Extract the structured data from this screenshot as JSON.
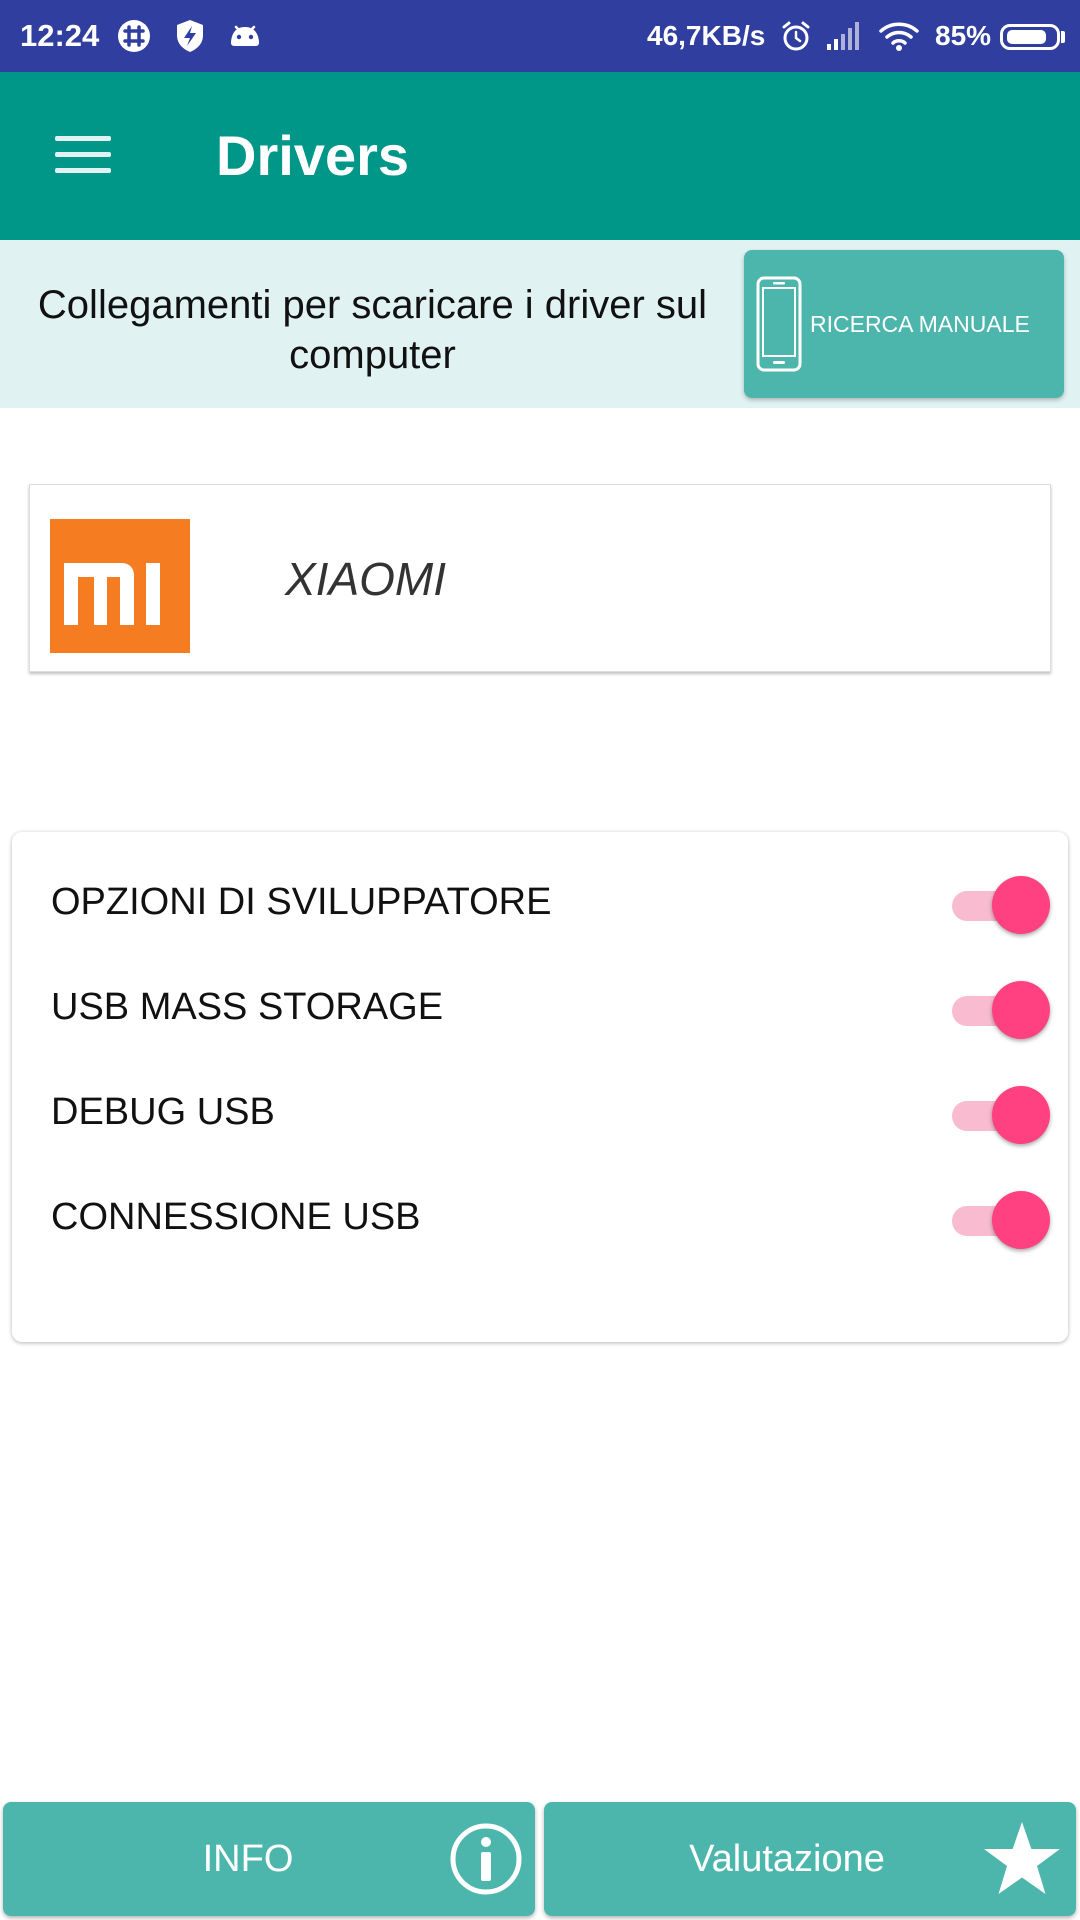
{
  "status_bar": {
    "time": "12:24",
    "notification_icons": [
      "slack-icon",
      "shield-bolt-icon",
      "android-icon"
    ],
    "network_speed": "46,7KB/s",
    "system_icons": [
      "alarm-icon",
      "signal-icon",
      "wifi-icon"
    ],
    "battery": "85%",
    "battery_level": 0.85
  },
  "toolbar": {
    "title": "Drivers",
    "menu_icon": "hamburger-menu-icon"
  },
  "banner": {
    "text": "Collegamenti per scaricare i driver sul computer",
    "manual_button_label": "RICERCA MANUALE",
    "manual_button_icon": "smartphone-icon"
  },
  "brand": {
    "name": "XIAOMI",
    "logo_text": "MI"
  },
  "options": [
    {
      "label": "OPZIONI DI SVILUPPATORE",
      "enabled": true
    },
    {
      "label": "USB MASS STORAGE",
      "enabled": true
    },
    {
      "label": "DEBUG USB",
      "enabled": true
    },
    {
      "label": "CONNESSIONE USB",
      "enabled": true
    }
  ],
  "bottom_buttons": {
    "info_label": "INFO",
    "info_icon": "info-icon",
    "rating_label": "Valutazione",
    "rating_icon": "star-icon"
  },
  "colors": {
    "status_bar": "#303F9F",
    "toolbar": "#009688",
    "banner_bg": "#E0F2F1",
    "button": "#4DB6AC",
    "switch_thumb": "#FF4081",
    "switch_track": "#F8BBD0",
    "brand_orange": "#F57C20"
  }
}
